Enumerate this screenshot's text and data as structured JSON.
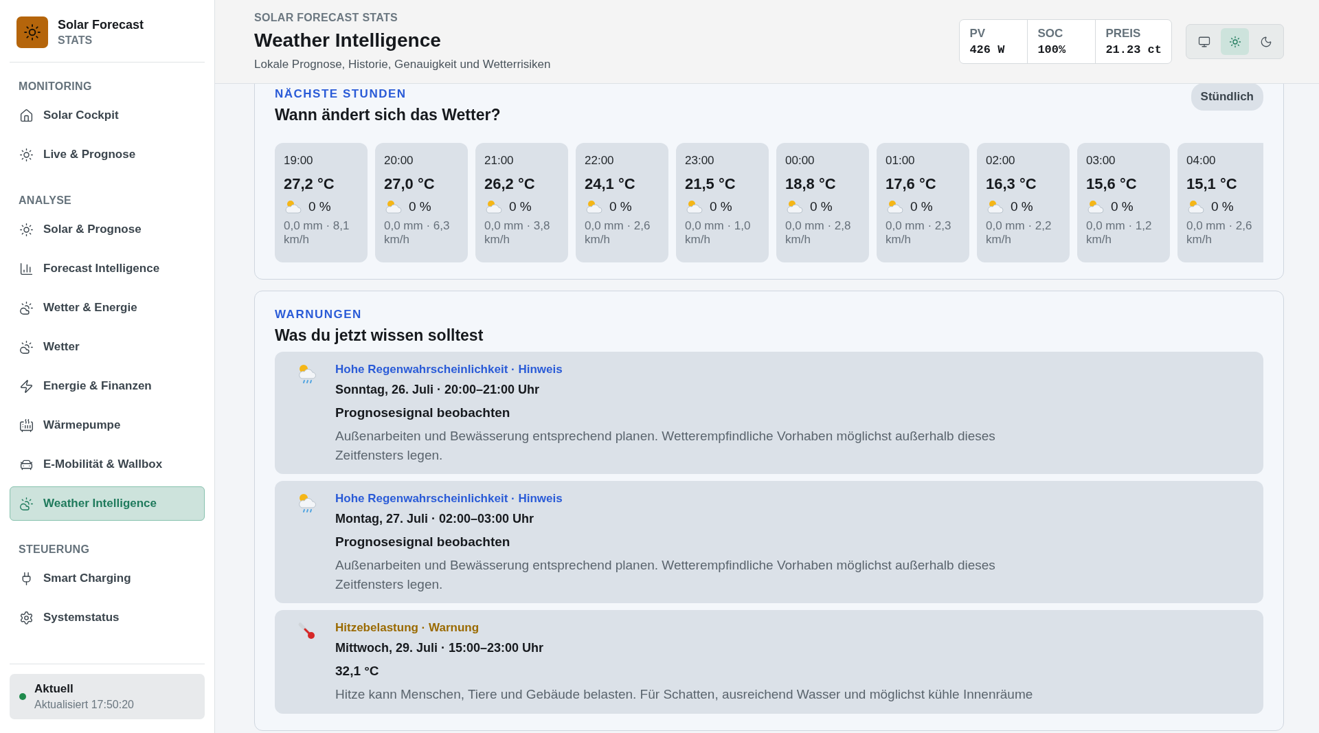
{
  "brand": {
    "title": "Solar Forecast",
    "subtitle": "STATS"
  },
  "nav": [
    {
      "title": "MONITORING",
      "items": [
        {
          "label": "Solar Cockpit",
          "selected": false
        },
        {
          "label": "Live & Prognose",
          "selected": false
        }
      ]
    },
    {
      "title": "ANALYSE",
      "items": [
        {
          "label": "Solar & Prognose",
          "selected": false
        },
        {
          "label": "Forecast Intelligence",
          "selected": false
        },
        {
          "label": "Wetter & Energie",
          "selected": false
        },
        {
          "label": "Wetter",
          "selected": false
        },
        {
          "label": "Energie & Finanzen",
          "selected": false
        },
        {
          "label": "Wärmepumpe",
          "selected": false
        },
        {
          "label": "E-Mobilität & Wallbox",
          "selected": false
        },
        {
          "label": "Weather Intelligence",
          "selected": true
        }
      ]
    },
    {
      "title": "STEUERUNG",
      "items": [
        {
          "label": "Smart Charging",
          "selected": false
        },
        {
          "label": "Systemstatus",
          "selected": false
        }
      ]
    }
  ],
  "status": {
    "title": "Aktuell",
    "subtitle": "Aktualisiert 17:50:20",
    "online": true
  },
  "header": {
    "kicker": "SOLAR FORECAST STATS",
    "title": "Weather Intelligence",
    "subtitle": "Lokale Prognose, Historie, Genauigkeit und Wetterrisiken"
  },
  "stats": [
    {
      "label": "PV",
      "value": "426 W"
    },
    {
      "label": "SOC",
      "value": "100%"
    },
    {
      "label": "PREIS",
      "value": "21.23 ct"
    }
  ],
  "theme_buttons": [
    {
      "kind": "system",
      "selected": false
    },
    {
      "kind": "light",
      "selected": true
    },
    {
      "kind": "dark",
      "selected": false
    }
  ],
  "hourly": {
    "kicker": "NÄCHSTE STUNDEN",
    "title": "Wann ändert sich das Wetter?",
    "badge": "Stündlich",
    "hours": [
      {
        "time": "19:00",
        "temp": "27,2 °C",
        "rain": "0 %",
        "detail": "0,0 mm · 8,1 km/h"
      },
      {
        "time": "20:00",
        "temp": "27,0 °C",
        "rain": "0 %",
        "detail": "0,0 mm · 6,3 km/h"
      },
      {
        "time": "21:00",
        "temp": "26,2 °C",
        "rain": "0 %",
        "detail": "0,0 mm · 3,8 km/h"
      },
      {
        "time": "22:00",
        "temp": "24,1 °C",
        "rain": "0 %",
        "detail": "0,0 mm · 2,6 km/h"
      },
      {
        "time": "23:00",
        "temp": "21,5 °C",
        "rain": "0 %",
        "detail": "0,0 mm · 1,0 km/h"
      },
      {
        "time": "00:00",
        "temp": "18,8 °C",
        "rain": "0 %",
        "detail": "0,0 mm · 2,8 km/h"
      },
      {
        "time": "01:00",
        "temp": "17,6 °C",
        "rain": "0 %",
        "detail": "0,0 mm · 2,3 km/h"
      },
      {
        "time": "02:00",
        "temp": "16,3 °C",
        "rain": "0 %",
        "detail": "0,0 mm · 2,2 km/h"
      },
      {
        "time": "03:00",
        "temp": "15,6 °C",
        "rain": "0 %",
        "detail": "0,0 mm · 1,2 km/h"
      },
      {
        "time": "04:00",
        "temp": "15,1 °C",
        "rain": "0 %",
        "detail": "0,0 mm · 2,6 km/h"
      }
    ]
  },
  "warnings": {
    "kicker": "WARNUNGEN",
    "title": "Was du jetzt wissen solltest",
    "items": [
      {
        "kind": "rain",
        "label": "Hohe Regenwahrscheinlichkeit · Hinweis",
        "when": "Sonntag, 26. Juli · 20:00–21:00 Uhr",
        "headline": "Prognosesignal beobachten",
        "text": "Außenarbeiten und Bewässerung entsprechend planen. Wetterempfindliche Vorhaben möglichst außerhalb dieses Zeitfensters legen."
      },
      {
        "kind": "rain",
        "label": "Hohe Regenwahrscheinlichkeit · Hinweis",
        "when": "Montag, 27. Juli · 02:00–03:00 Uhr",
        "headline": "Prognosesignal beobachten",
        "text": "Außenarbeiten und Bewässerung entsprechend planen. Wetterempfindliche Vorhaben möglichst außerhalb dieses Zeitfensters legen."
      },
      {
        "kind": "heat",
        "label": "Hitzebelastung · Warnung",
        "when": "Mittwoch, 29. Juli · 15:00–23:00 Uhr",
        "headline": "32,1 °C",
        "text": "Hitze kann Menschen, Tiere und Gebäude belasten. Für Schatten, ausreichend Wasser und möglichst kühle Innenräume"
      }
    ]
  }
}
